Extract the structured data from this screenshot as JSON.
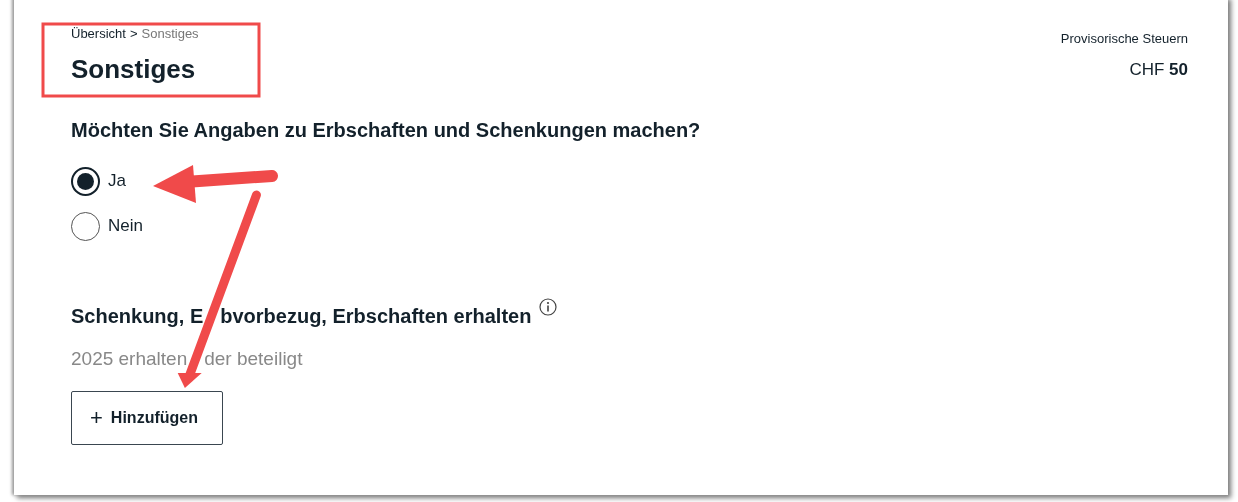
{
  "breadcrumb": {
    "items": [
      {
        "label": "Übersicht",
        "current": false
      },
      {
        "label": "Sonstiges",
        "current": true
      }
    ],
    "separator": ">"
  },
  "page_title": "Sonstiges",
  "tax_summary": {
    "label": "Provisorische Steuern",
    "amount": "CHF **50**"
  },
  "question": {
    "text": "Möchten Sie Angaben zu Erbschaften und Schenkungen machen?",
    "options": [
      {
        "label": "Ja",
        "selected": true
      },
      {
        "label": "Nein",
        "selected": false
      }
    ]
  },
  "section": {
    "title_parts": [
      "Schenkung, E",
      "bvorbezug, Erbschaften erhalten"
    ],
    "subtitle_parts": [
      "2025 erhalten",
      "der beteiligt"
    ],
    "add_button": {
      "icon": "+",
      "label": "Hinzufügen"
    }
  }
}
